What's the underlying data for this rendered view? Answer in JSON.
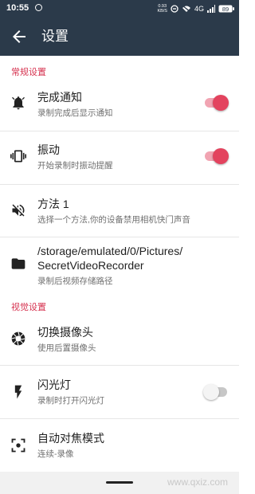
{
  "status_bar": {
    "time": "10:55",
    "net_speed_value": "0.93",
    "net_speed_unit": "KB/S",
    "network": "4G",
    "battery_level": "89"
  },
  "app_bar": {
    "title": "设置"
  },
  "sections": {
    "general": "常规设置",
    "visual": "视觉设置"
  },
  "settings": {
    "notify": {
      "title": "完成通知",
      "subtitle": "录制完成后显示通知",
      "enabled": true
    },
    "vibrate": {
      "title": "振动",
      "subtitle": "开始录制时振动提醒",
      "enabled": true
    },
    "method": {
      "title": "方法 1",
      "subtitle": "选择一个方法,你的设备禁用相机快门声音"
    },
    "path": {
      "title_line1": "/storage/emulated/0/Pictures/",
      "title_line2": "SecretVideoRecorder",
      "subtitle": "录制后视频存储路径"
    },
    "camera": {
      "title": "切换摄像头",
      "subtitle": "使用后置摄像头"
    },
    "flash": {
      "title": "闪光灯",
      "subtitle": "录制时打开闪光灯",
      "enabled": false
    },
    "focus": {
      "title": "自动对焦模式",
      "subtitle": "连续-录像"
    }
  },
  "watermark": "www.qxiz.com",
  "colors": {
    "appbar": "#2b3a4a",
    "accent": "#e3435e",
    "section": "#d6324f"
  }
}
